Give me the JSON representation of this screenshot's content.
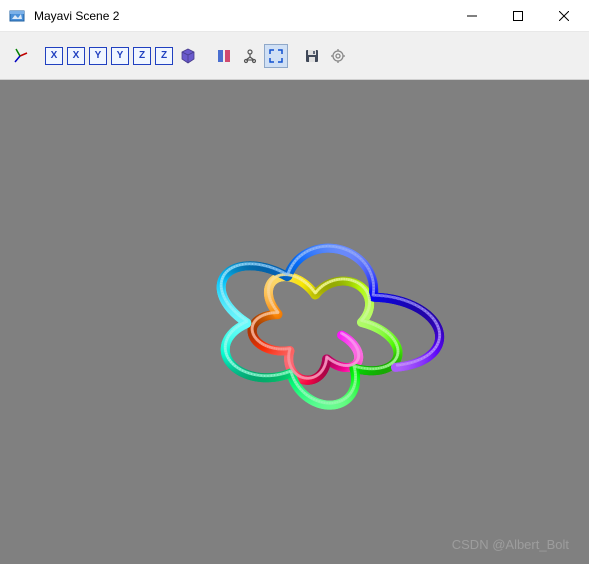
{
  "window": {
    "title": "Mayavi Scene 2"
  },
  "toolbar": {
    "views": [
      "X",
      "X",
      "Y",
      "Y",
      "Z",
      "Z"
    ]
  },
  "watermark": "CSDN @Albert_Bolt",
  "chart_data": {
    "type": "plot3d-tube",
    "description": "Rainbow spiral torus knot rendered with Mayavi plot3d",
    "colormap": "hsv",
    "tube_radius": 0.1,
    "approx_loops": 11
  }
}
